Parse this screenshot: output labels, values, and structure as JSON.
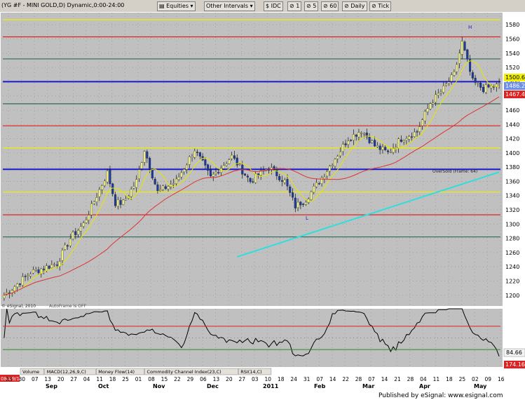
{
  "toolbar": {
    "symbol": "(YG #F - MINI GOLD,D) Dynamic,0:00-24:00",
    "sheet": "Equities",
    "interval_menu": "Other Intervals",
    "feed": "IDC",
    "intervals": [
      "1",
      "5",
      "60",
      "Daily",
      "Tick"
    ]
  },
  "price_flags": {
    "last": "1500.6",
    "prev": "1486.2",
    "stop": "1467.4"
  },
  "studies": [
    "Volume",
    "MACD(12,26,9,C)",
    "Money Flow(14)",
    "Commodity Channel Index(23,C)",
    "RSI(14,C)"
  ],
  "date_flag": "08/09/10",
  "rsi_flags": {
    "upper": "84.66",
    "lower": "174.16"
  },
  "footer_credit": "Published by eSignal: www.esignal.com",
  "copyright": "© eSignal, 2010",
  "autoframe_note": "AutoFrame is OFF",
  "oversold_note": "OverSold (Frame: 64)",
  "colors": {
    "background": "#c0c0c0",
    "up_candle": "#eeee88",
    "down_candle": "#1c3a98",
    "ma_short": "#e6e600",
    "ma_long": "#dd3333",
    "trendline": "#33dddd",
    "level_red": "#dd2222",
    "level_yellow": "#f0f000",
    "level_blue": "#1a1acc",
    "level_teal": "#2e6a5e"
  },
  "chart_data": {
    "type": "candlestick",
    "title": "(YG #F - MINI GOLD,D) Dynamic,0:00-24:00",
    "ylim": [
      1185,
      1597
    ],
    "y_ticks": [
      1200,
      1220,
      1240,
      1260,
      1280,
      1300,
      1320,
      1340,
      1360,
      1380,
      1400,
      1420,
      1440,
      1460,
      1480,
      1500,
      1520,
      1540,
      1560,
      1580
    ],
    "x_tick_labels": [
      "23",
      "30",
      "07",
      "13",
      "20",
      "27",
      "04",
      "11",
      "18",
      "25",
      "01",
      "08",
      "15",
      "22",
      "29",
      "06",
      "13",
      "20",
      "27",
      "03",
      "10",
      "18",
      "24",
      "31",
      "07",
      "14",
      "22",
      "28",
      "07",
      "14",
      "21",
      "28",
      "04",
      "11",
      "18",
      "25",
      "02",
      "09",
      "16"
    ],
    "month_labels": [
      "Sep",
      "Oct",
      "Nov",
      "Dec",
      "2011",
      "Jan",
      "Feb",
      "Mar",
      "Apr",
      "May"
    ],
    "close_anchors": [
      [
        0,
        1200
      ],
      [
        10,
        1232
      ],
      [
        20,
        1245
      ],
      [
        25,
        1280
      ],
      [
        30,
        1300
      ],
      [
        35,
        1340
      ],
      [
        39,
        1372
      ],
      [
        42,
        1330
      ],
      [
        45,
        1330
      ],
      [
        50,
        1360
      ],
      [
        53,
        1405
      ],
      [
        58,
        1345
      ],
      [
        65,
        1360
      ],
      [
        72,
        1405
      ],
      [
        78,
        1365
      ],
      [
        86,
        1395
      ],
      [
        93,
        1360
      ],
      [
        100,
        1380
      ],
      [
        106,
        1360
      ],
      [
        110,
        1325
      ],
      [
        114,
        1335
      ],
      [
        120,
        1365
      ],
      [
        130,
        1420
      ],
      [
        135,
        1432
      ],
      [
        140,
        1410
      ],
      [
        145,
        1400
      ],
      [
        150,
        1420
      ],
      [
        156,
        1430
      ],
      [
        161,
        1470
      ],
      [
        166,
        1490
      ],
      [
        170,
        1510
      ],
      [
        173,
        1555
      ],
      [
        177,
        1500
      ],
      [
        181,
        1490
      ],
      [
        187,
        1495
      ]
    ],
    "horizontal_levels": [
      {
        "price": 1587,
        "color": "yellow"
      },
      {
        "price": 1563,
        "color": "red"
      },
      {
        "price": 1532,
        "color": "teal"
      },
      {
        "price": 1500,
        "color": "blue"
      },
      {
        "price": 1469,
        "color": "teal"
      },
      {
        "price": 1438,
        "color": "red"
      },
      {
        "price": 1407,
        "color": "yellow"
      },
      {
        "price": 1377,
        "color": "blue"
      },
      {
        "price": 1345,
        "color": "yellow"
      },
      {
        "price": 1313,
        "color": "red"
      },
      {
        "price": 1282,
        "color": "teal"
      }
    ],
    "trendline": [
      [
        88,
        1254
      ],
      [
        187,
        1373
      ]
    ],
    "rsi_levels": [
      70,
      50,
      30
    ]
  }
}
